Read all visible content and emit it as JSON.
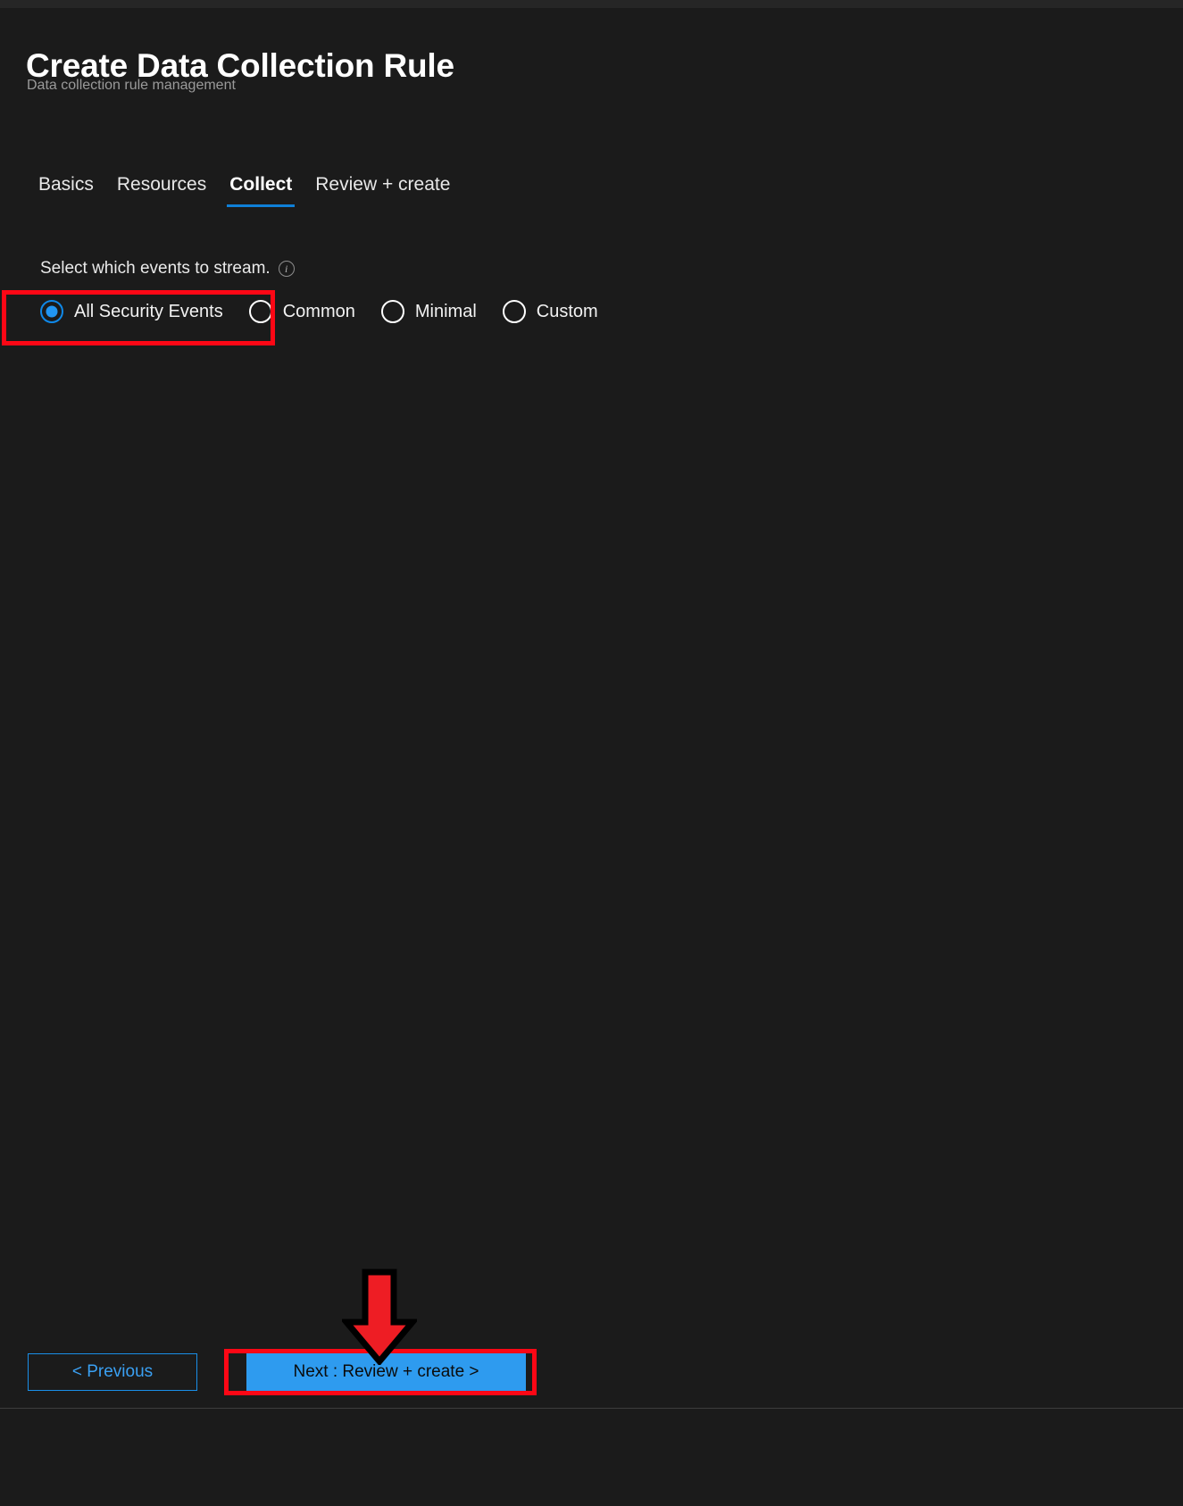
{
  "window": {
    "title": "Create Data Collection Rule",
    "subtitle": "Data collection rule management"
  },
  "tabs": [
    {
      "label": "Basics",
      "active": false
    },
    {
      "label": "Resources",
      "active": false
    },
    {
      "label": "Collect",
      "active": true
    },
    {
      "label": "Review + create",
      "active": false
    }
  ],
  "collect": {
    "instruction": "Select which events to stream.",
    "info_icon": "info-icon",
    "info_icon_glyph": "i",
    "options": [
      {
        "label": "All Security Events",
        "checked": true
      },
      {
        "label": "Common",
        "checked": false
      },
      {
        "label": "Minimal",
        "checked": false
      },
      {
        "label": "Custom",
        "checked": false
      }
    ]
  },
  "footer": {
    "previous_label": "< Previous",
    "next_label": "Next : Review + create >"
  },
  "annotations": {
    "highlight_color": "#fd0715",
    "arrow_color": "#ee1d24",
    "arrow_outline": "#000000",
    "targets": [
      "all-security-events-radio",
      "next-review-create-button"
    ]
  },
  "colors": {
    "background": "#1b1b1b",
    "top_strip": "#262626",
    "accent": "#0f80d8",
    "primary_button": "#2e9bef",
    "link": "#3aa0f3",
    "radio_selected": "#2196f3",
    "subtitle_text": "#9a9a9a",
    "divider": "#3d3d3d"
  }
}
